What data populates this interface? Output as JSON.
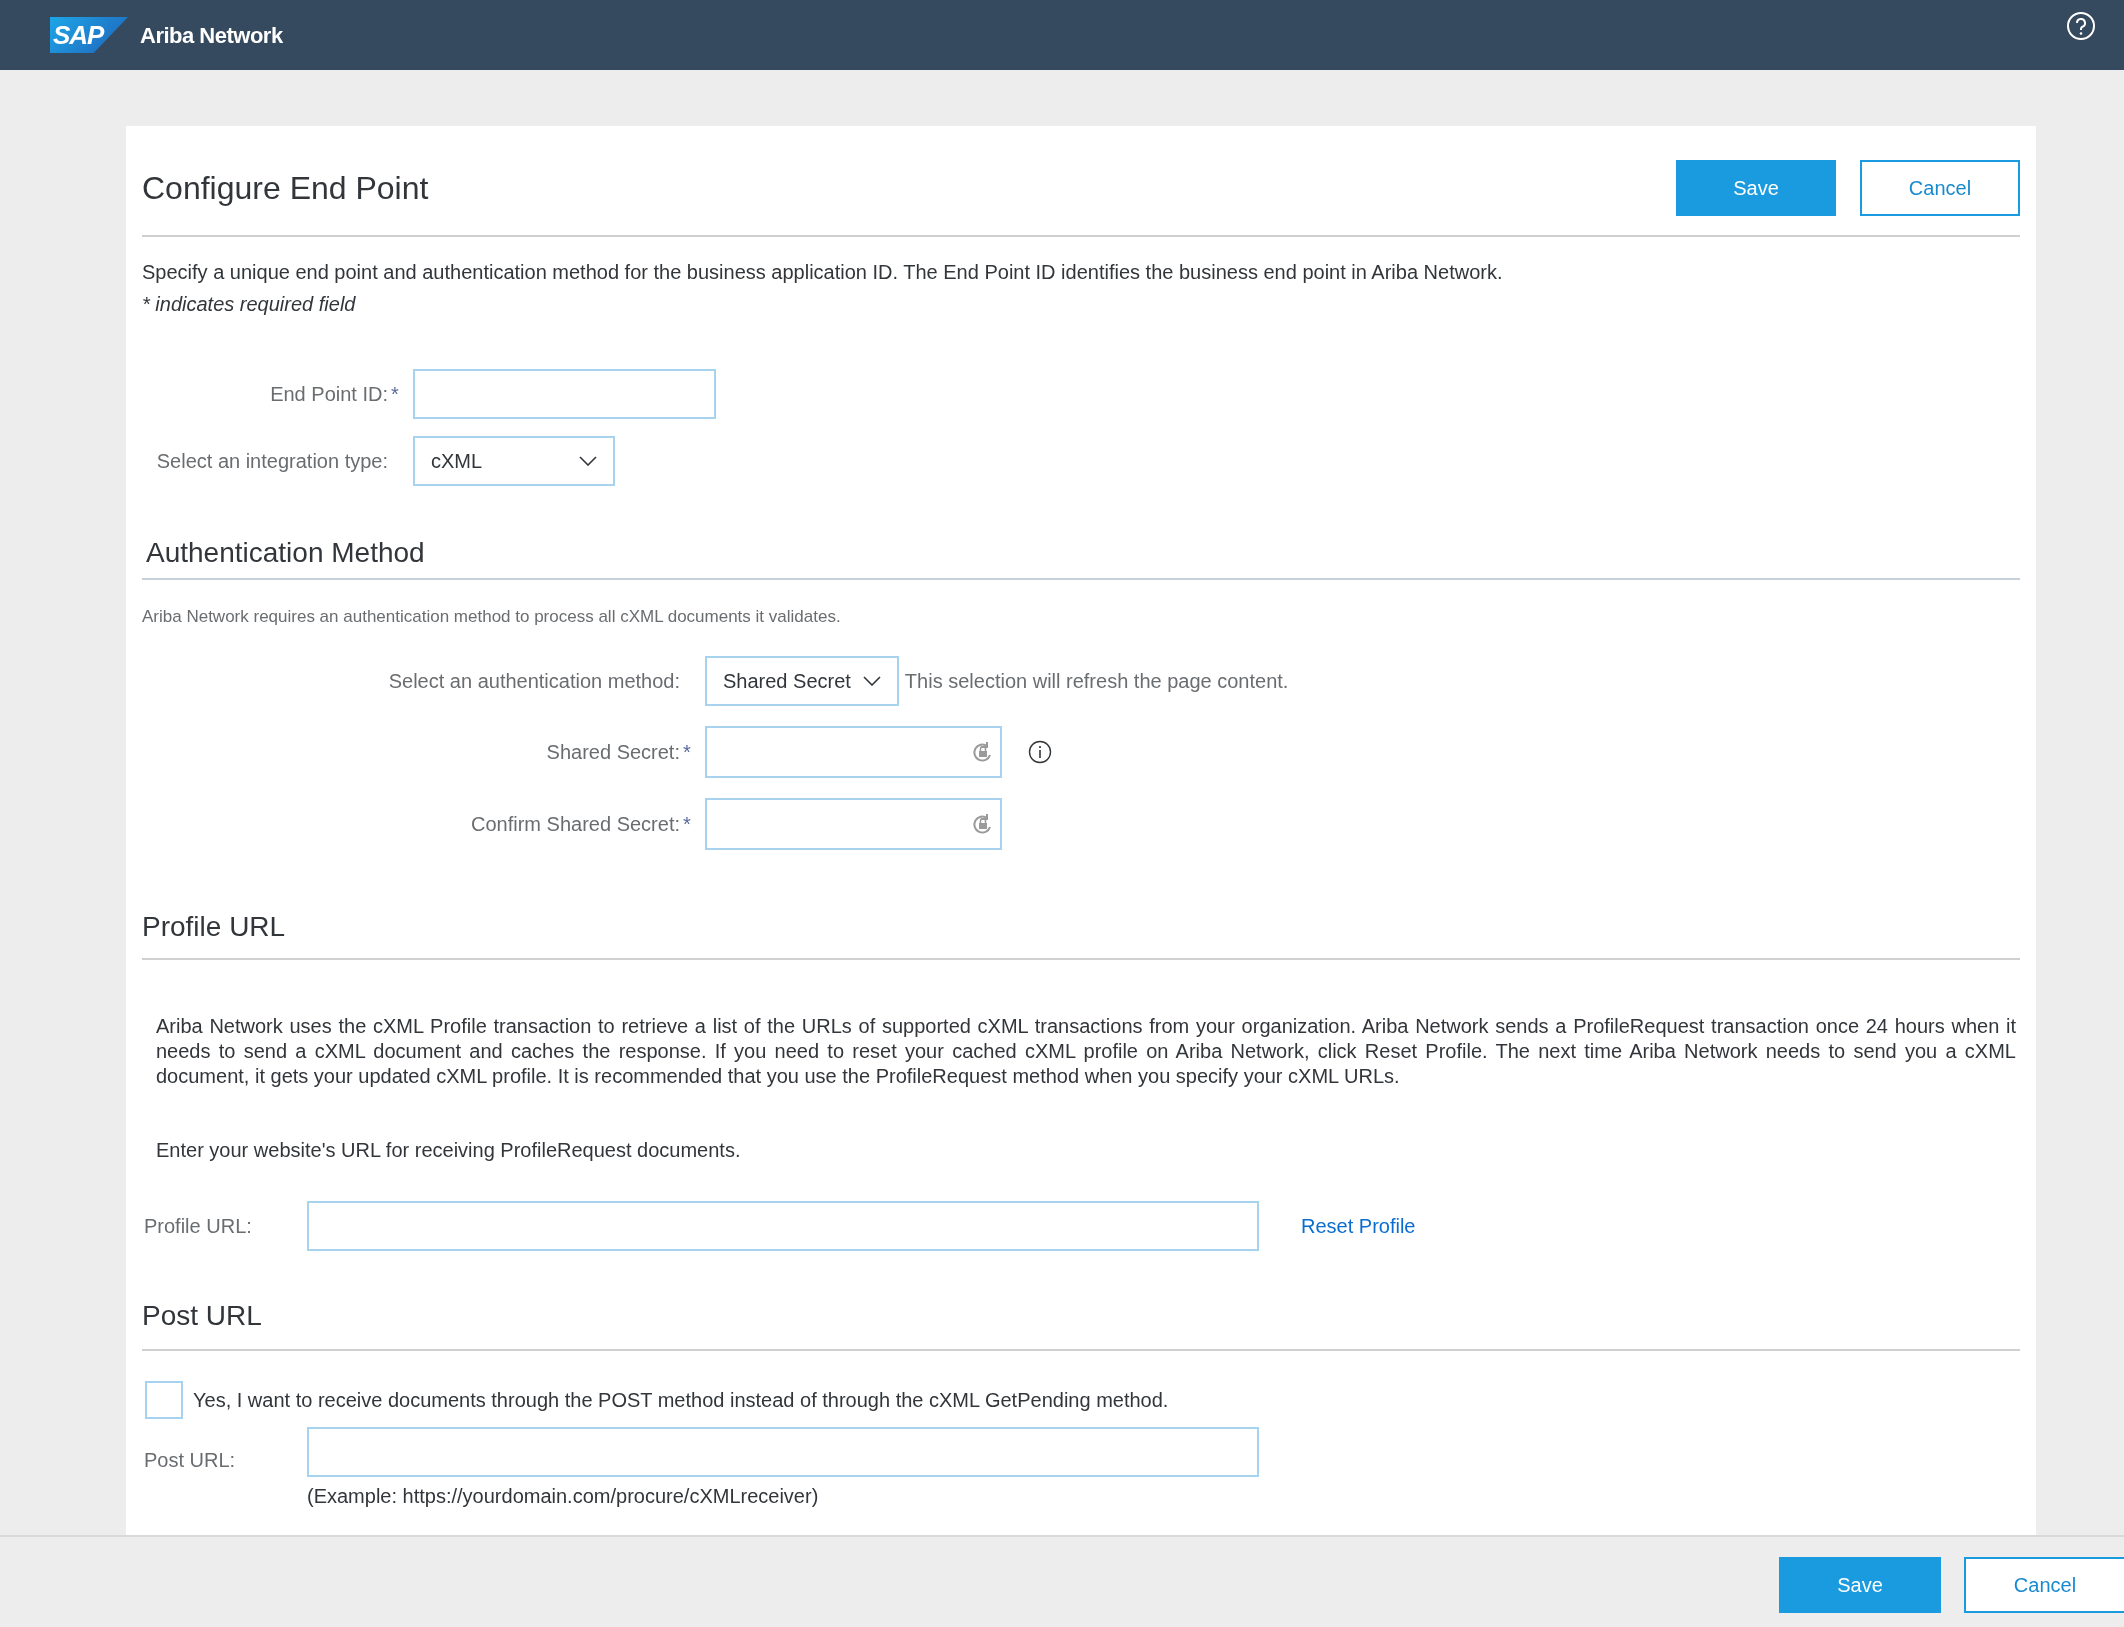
{
  "header": {
    "brand": "SAP",
    "product": "Ariba Network"
  },
  "page": {
    "title": "Configure End Point",
    "buttons": [
      {
        "label": "Save",
        "kind": "primary"
      },
      {
        "label": "Cancel",
        "kind": "secondary"
      }
    ],
    "description": "Specify a unique end point and authentication method for the business application ID. The End Point ID identifies the business end point in Ariba Network.",
    "required_note": "* indicates required field",
    "fields": [
      {
        "label": "End Point ID:",
        "mark": "*",
        "kind": "text"
      },
      {
        "label": "Select an integration type:",
        "kind": "select",
        "value": "cXML"
      }
    ]
  },
  "authentication": {
    "heading": "Authentication Method",
    "note": "Ariba Network requires an authentication method to process all cXML documents it validates.",
    "fields": [
      {
        "label": "Select an authentication method:",
        "kind": "select",
        "value": "Shared Secret",
        "hint": "This selection will refresh the page content."
      },
      {
        "label": "Shared Secret:",
        "mark": "*",
        "kind": "password",
        "info": true
      },
      {
        "label": "Confirm Shared Secret:",
        "mark": "*",
        "kind": "password"
      }
    ]
  },
  "profile": {
    "heading": "Profile URL",
    "paragraph": "Ariba Network uses the cXML Profile transaction to retrieve a list of the URLs of supported cXML transactions from your organization. Ariba Network sends a ProfileRequest transaction once 24 hours when it needs to send a cXML document and caches the response. If you need to reset your cached cXML profile on Ariba Network, click Reset Profile. The next time Ariba Network needs to send you a cXML document, it gets your updated cXML profile. It is recommended that you use the ProfileRequest method when you specify your cXML URLs.",
    "instruction": "Enter your website's URL for receiving ProfileRequest documents.",
    "label": "Profile URL:",
    "link": "Reset Profile"
  },
  "post": {
    "heading": "Post URL",
    "checkbox": {
      "label": "Yes, I want to receive documents through the POST method instead of through the cXML GetPending method.",
      "checked": false
    },
    "label": "Post URL:",
    "example": "(Example: https://yourdomain.com/procure/cXMLreceiver)"
  },
  "footer": {
    "buttons": [
      {
        "label": "Save",
        "kind": "primary"
      },
      {
        "label": "Cancel",
        "kind": "secondary"
      }
    ]
  }
}
